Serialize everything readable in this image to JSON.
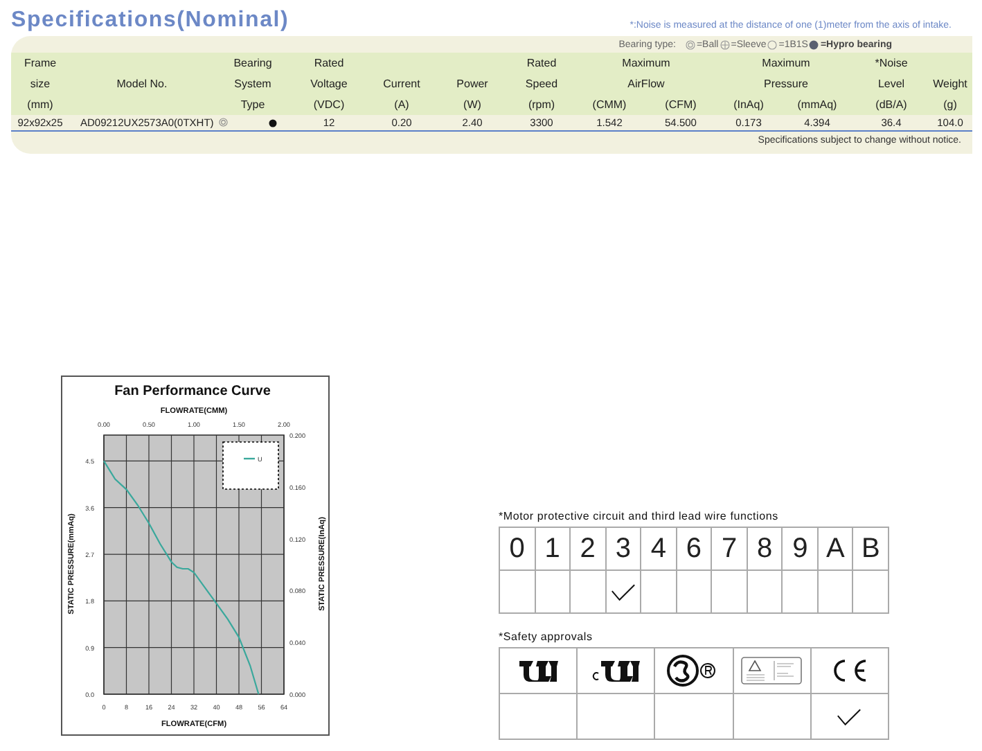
{
  "header": {
    "title": "Specifications(Nominal)",
    "note": "*:Noise is measured at the distance of one (1)meter from the axis of intake."
  },
  "bearing_legend": {
    "label": "Bearing type:",
    "items": [
      {
        "kind": "ball",
        "label": "=Ball"
      },
      {
        "kind": "sleeve",
        "label": "=Sleeve"
      },
      {
        "kind": "combo",
        "label": "=1B1S"
      },
      {
        "kind": "hypro",
        "label": "=Hypro bearing"
      }
    ]
  },
  "table": {
    "header": [
      {
        "kind": "single",
        "lines": [
          "Frame",
          "size",
          "(mm)"
        ]
      },
      {
        "kind": "single",
        "lines": [
          "Model No."
        ]
      },
      {
        "kind": "single",
        "lines": [
          "Bearing",
          "System",
          "Type"
        ]
      },
      {
        "kind": "single",
        "lines": [
          "Rated",
          "Voltage",
          "(VDC)"
        ]
      },
      {
        "kind": "single",
        "lines": [
          "Current",
          "(A)"
        ]
      },
      {
        "kind": "single",
        "lines": [
          "Power",
          "(W)"
        ]
      },
      {
        "kind": "single",
        "lines": [
          "Rated",
          "Speed",
          "(rpm)"
        ]
      },
      {
        "kind": "group",
        "lines": [
          "Maximum",
          "AirFlow"
        ],
        "units": [
          "(CMM)",
          "(CFM)"
        ]
      },
      {
        "kind": "group",
        "lines": [
          "Maximum",
          "Pressure"
        ],
        "units": [
          "(InAq)",
          "(mmAq)"
        ]
      },
      {
        "kind": "single",
        "lines": [
          "*Noise",
          "Level",
          "(dB/A)"
        ]
      },
      {
        "kind": "single",
        "lines": [
          "Weight",
          "(g)"
        ]
      }
    ],
    "rows": [
      {
        "cells": [
          "92x92x25",
          "AD09212UX2573A0(0TXHT)"
        ],
        "bearing": [
          {
            "kind": "ball"
          },
          {
            "kind": "hypro"
          }
        ],
        "values": [
          "12",
          "0.20",
          "2.40",
          "3300",
          "1.542",
          "54.500",
          "0.173",
          "4.394",
          "36.4",
          "104.0"
        ]
      }
    ],
    "footnote": "Specifications subject to change without notice."
  },
  "performance": {
    "chart_data": {
      "type": "line",
      "title": "Fan Performance Curve",
      "xlabel": "FLOWRATE(CFM)",
      "ylabel": "STATIC PRESSURE(mmAq)",
      "x": [
        0,
        4,
        8,
        12,
        16,
        20,
        24,
        26,
        28,
        30,
        32,
        36,
        40,
        44,
        48,
        52,
        55
      ],
      "series": [
        {
          "name": "U",
          "color": "#3aa89c",
          "values": [
            4.5,
            4.15,
            3.95,
            3.65,
            3.3,
            2.9,
            2.55,
            2.45,
            2.42,
            2.42,
            2.35,
            2.05,
            1.75,
            1.45,
            1.1,
            0.55,
            0
          ]
        }
      ],
      "grid": true,
      "xlim": [
        0,
        64
      ],
      "ylim": [
        0,
        5
      ],
      "xticks": [
        0,
        8,
        16,
        24,
        32,
        40,
        48,
        56,
        64
      ],
      "yticks": [
        {
          "value": 0,
          "label": "0.0"
        },
        {
          "value": 0.9,
          "label": "0.9"
        },
        {
          "value": 1.8,
          "label": "1.8"
        },
        {
          "value": 2.7,
          "label": "2.7"
        },
        {
          "value": 3.6,
          "label": "3.6"
        },
        {
          "value": 4.5,
          "label": "4.5"
        }
      ]
    },
    "top_axis": {
      "label": "FLOWRATE(CMM)",
      "ticks": [
        "0.00",
        "0.50",
        "1.00",
        "1.50",
        "2.00"
      ]
    },
    "right_axis": {
      "label": "STATIC PRESSURE(InAq)",
      "ticks": [
        "0.200",
        "0.160",
        "0.120",
        "0.080",
        "0.040",
        "0.000"
      ]
    }
  },
  "motor_functions": {
    "title": "*Motor protective circuit and third lead wire functions",
    "items": [
      {
        "label": "0",
        "checked": false
      },
      {
        "label": "1",
        "checked": false
      },
      {
        "label": "2",
        "checked": false
      },
      {
        "label": "3",
        "checked": true
      },
      {
        "label": "4",
        "checked": false
      },
      {
        "label": "6",
        "checked": false
      },
      {
        "label": "7",
        "checked": false
      },
      {
        "label": "8",
        "checked": false
      },
      {
        "label": "9",
        "checked": false
      },
      {
        "label": "A",
        "checked": false
      },
      {
        "label": "B",
        "checked": false
      }
    ]
  },
  "safety_approvals": {
    "title": "*Safety approvals",
    "items": [
      {
        "kind": "ul",
        "checked": false
      },
      {
        "kind": "cul",
        "checked": false
      },
      {
        "kind": "csa",
        "checked": false
      },
      {
        "kind": "tuv",
        "checked": false
      },
      {
        "kind": "ce",
        "checked": true
      }
    ]
  }
}
